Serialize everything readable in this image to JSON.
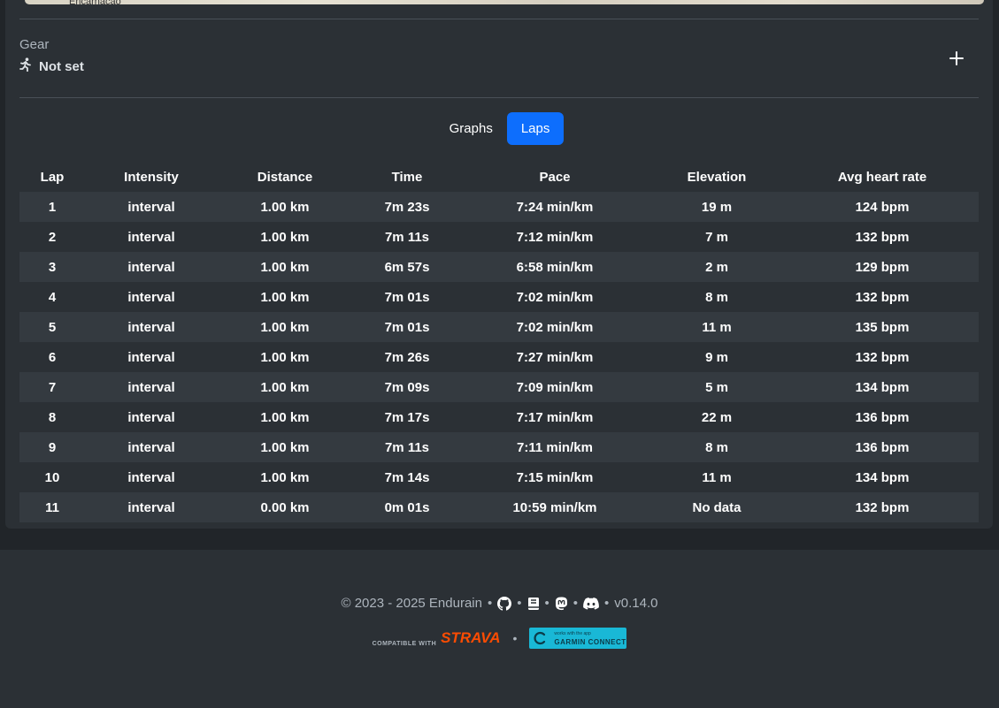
{
  "map": {
    "visible_label": "Encarnação"
  },
  "gear": {
    "label": "Gear",
    "value": "Not set",
    "icon": "running-icon",
    "add_icon": "plus-icon"
  },
  "tabs": [
    {
      "label": "Graphs",
      "active": false
    },
    {
      "label": "Laps",
      "active": true
    }
  ],
  "laps_table": {
    "headers": [
      "Lap",
      "Intensity",
      "Distance",
      "Time",
      "Pace",
      "Elevation",
      "Avg heart rate"
    ],
    "rows": [
      [
        "1",
        "interval",
        "1.00 km",
        "7m 23s",
        "7:24 min/km",
        "19 m",
        "124 bpm"
      ],
      [
        "2",
        "interval",
        "1.00 km",
        "7m 11s",
        "7:12 min/km",
        "7 m",
        "132 bpm"
      ],
      [
        "3",
        "interval",
        "1.00 km",
        "6m 57s",
        "6:58 min/km",
        "2 m",
        "129 bpm"
      ],
      [
        "4",
        "interval",
        "1.00 km",
        "7m 01s",
        "7:02 min/km",
        "8 m",
        "132 bpm"
      ],
      [
        "5",
        "interval",
        "1.00 km",
        "7m 01s",
        "7:02 min/km",
        "11 m",
        "135 bpm"
      ],
      [
        "6",
        "interval",
        "1.00 km",
        "7m 26s",
        "7:27 min/km",
        "9 m",
        "132 bpm"
      ],
      [
        "7",
        "interval",
        "1.00 km",
        "7m 09s",
        "7:09 min/km",
        "5 m",
        "134 bpm"
      ],
      [
        "8",
        "interval",
        "1.00 km",
        "7m 17s",
        "7:17 min/km",
        "22 m",
        "136 bpm"
      ],
      [
        "9",
        "interval",
        "1.00 km",
        "7m 11s",
        "7:11 min/km",
        "8 m",
        "136 bpm"
      ],
      [
        "10",
        "interval",
        "1.00 km",
        "7m 14s",
        "7:15 min/km",
        "11 m",
        "134 bpm"
      ],
      [
        "11",
        "interval",
        "0.00 km",
        "0m 01s",
        "10:59 min/km",
        "No data",
        "132 bpm"
      ]
    ]
  },
  "footer": {
    "copyright": "© 2023 - 2025 Endurain",
    "separator": "•",
    "version": "v0.14.0",
    "icons": [
      "github-icon",
      "book-icon",
      "mastodon-icon",
      "discord-icon"
    ],
    "strava_badge": {
      "prefix": "COMPATIBLE WITH",
      "brand": "STRAVA"
    },
    "garmin_badge": {
      "small": "works with the app",
      "brand": "GARMIN CONNECT"
    }
  },
  "colors": {
    "background": "#212529",
    "card": "#2b3035",
    "accent": "#0d6efd",
    "strava": "#fc4c02",
    "garmin": "#19b8d6"
  }
}
